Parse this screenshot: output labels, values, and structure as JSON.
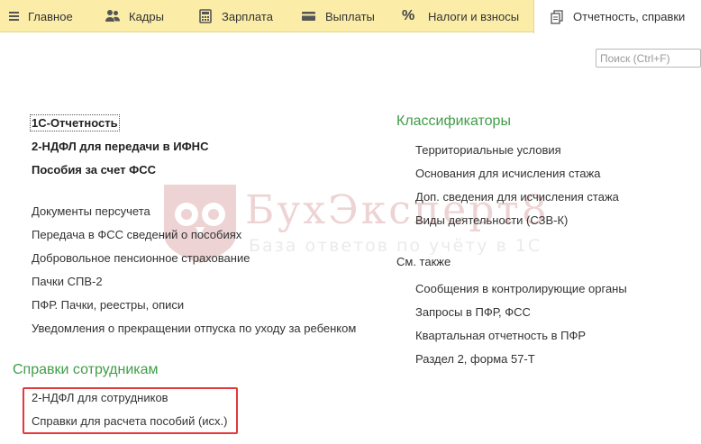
{
  "menu": {
    "tabs": [
      {
        "label": "Главное",
        "icon": "hamburger-icon"
      },
      {
        "label": "Кадры",
        "icon": "people-icon"
      },
      {
        "label": "Зарплата",
        "icon": "calculator-icon"
      },
      {
        "label": "Выплаты",
        "icon": "wallet-icon"
      },
      {
        "label": "Налоги и взносы",
        "icon": "percent-icon"
      },
      {
        "label": "Отчетность, справки",
        "icon": "documents-icon",
        "active": true
      }
    ]
  },
  "search": {
    "placeholder": "Поиск (Ctrl+F)"
  },
  "reports": {
    "main": [
      "1С-Отчетность",
      "2-НДФЛ для передачи в ИФНС",
      "Пособия за счет ФСС"
    ],
    "other": [
      "Документы персучета",
      "Передача в ФСС сведений о пособиях",
      "Добровольное пенсионное страхование",
      "Пачки СПВ-2",
      "ПФР. Пачки, реестры, описи",
      "Уведомления о прекращении отпуска по уходу за ребенком"
    ]
  },
  "employee_certs": {
    "title": "Справки сотрудникам",
    "items": [
      "2-НДФЛ для сотрудников",
      "Справки для расчета пособий (исх.)"
    ]
  },
  "classifiers": {
    "title": "Классификаторы",
    "items": [
      "Территориальные условия",
      "Основания для исчисления стажа",
      "Доп. сведения для исчисления стажа",
      "Виды деятельности (СЗВ-К)"
    ]
  },
  "see_also": {
    "title": "См. также",
    "items": [
      "Сообщения в контролирующие органы",
      "Запросы в ПФР, ФСС",
      "Квартальная отчетность в ПФР",
      "Раздел 2, форма 57-Т"
    ]
  },
  "watermark": {
    "name": "БухЭксперт8",
    "tagline": "База ответов по учёту в 1С"
  },
  "colors": {
    "menu_bg": "#fbeda8",
    "group_title": "#3f9e47",
    "highlight": "#e3393c"
  }
}
